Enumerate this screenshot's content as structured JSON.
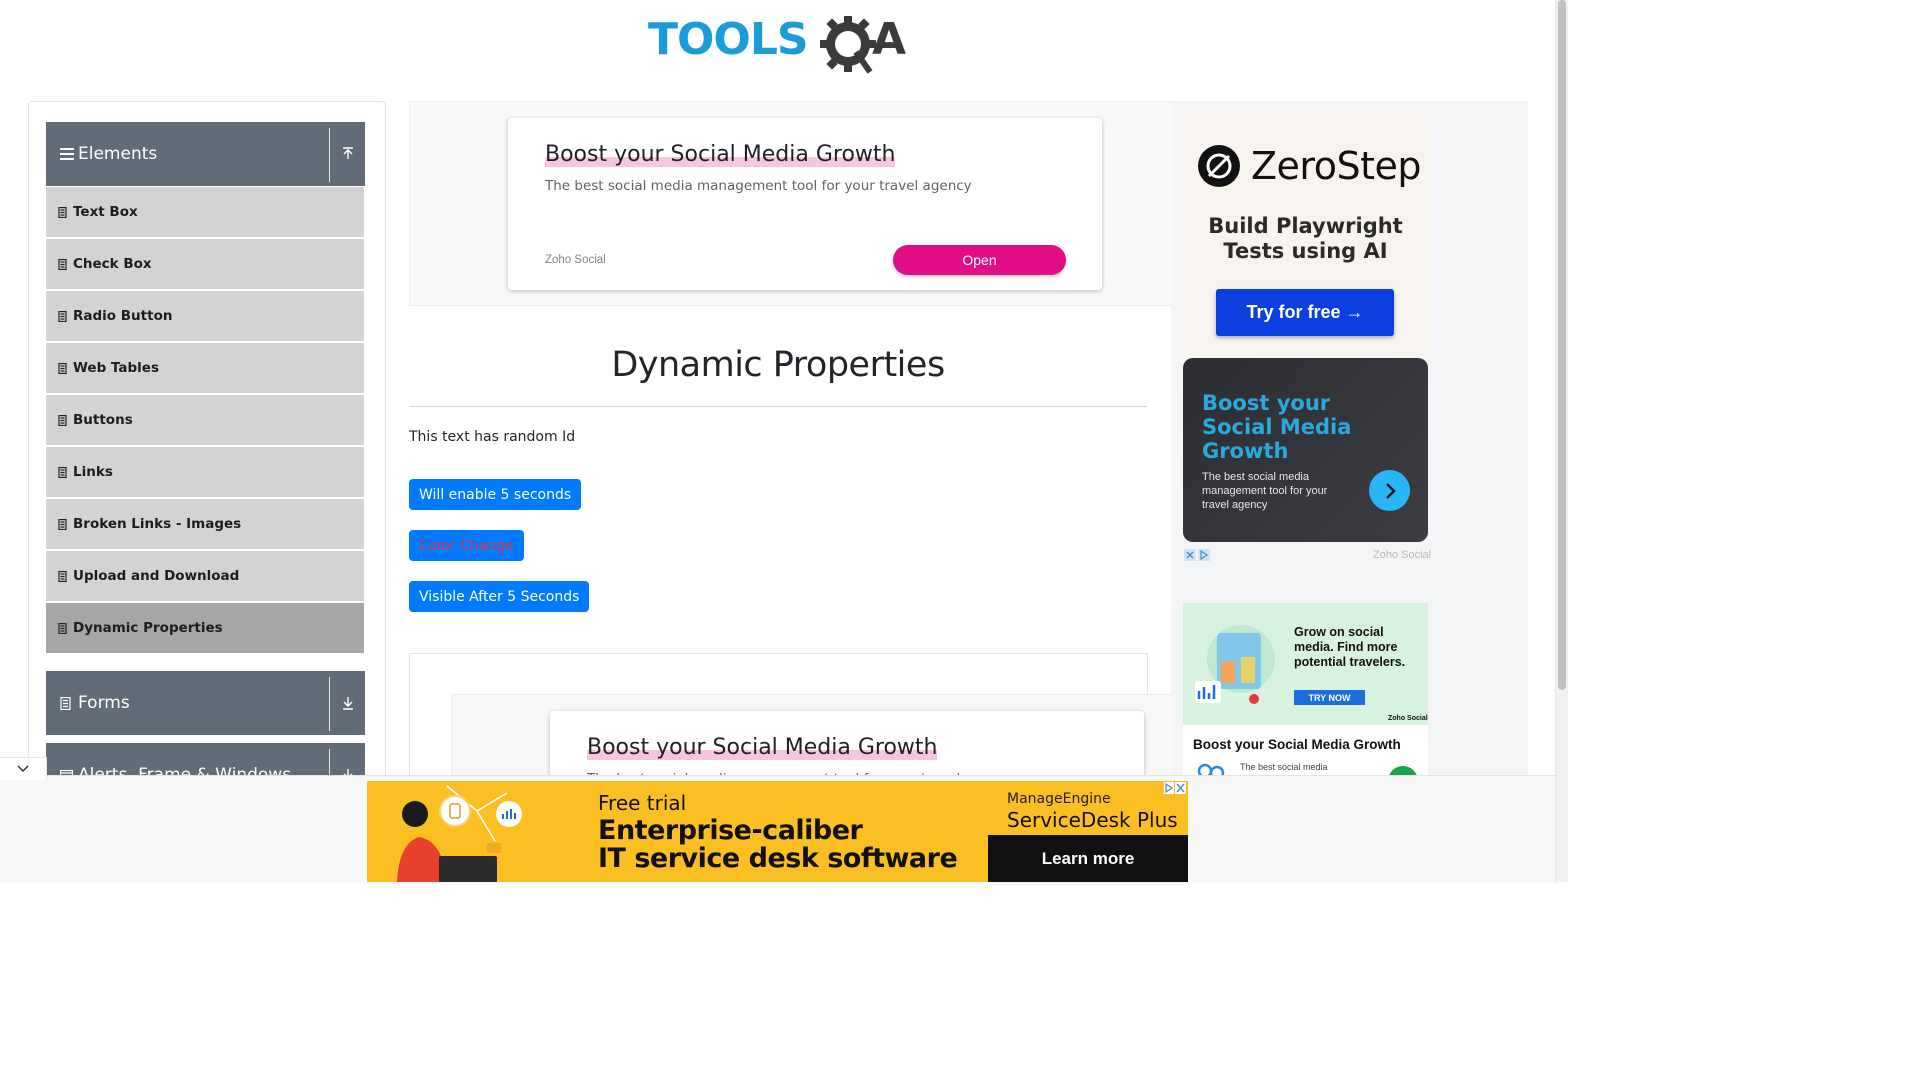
{
  "header": {
    "logo_text_left": "TOOLS",
    "logo_text_right": "A",
    "logo_alt": "ToolsQA"
  },
  "sidebar": {
    "groups": [
      {
        "title": "Elements",
        "toggle": "collapse"
      },
      {
        "title": "Forms",
        "toggle": "expand"
      },
      {
        "title": "Alerts, Frame & Windows",
        "toggle": "expand"
      }
    ],
    "items": [
      {
        "label": "Text Box"
      },
      {
        "label": "Check Box"
      },
      {
        "label": "Radio Button"
      },
      {
        "label": "Web Tables"
      },
      {
        "label": "Buttons"
      },
      {
        "label": "Links"
      },
      {
        "label": "Broken Links - Images"
      },
      {
        "label": "Upload and Download"
      },
      {
        "label": "Dynamic Properties",
        "active": true
      }
    ]
  },
  "top_ad": {
    "title": "Boost your Social Media Growth",
    "desc": "The best social media management tool for your travel agency",
    "brand": "Zoho Social",
    "cta": "Open"
  },
  "main": {
    "title": "Dynamic Properties",
    "random_text": "This text has random Id",
    "buttons": {
      "enable_after": "Will enable 5 seconds",
      "color_change": "Color Change",
      "visible_after": "Visible After 5 Seconds"
    }
  },
  "inner_ad": {
    "title": "Boost your Social Media Growth",
    "desc": "The best social media management tool for your travel agency"
  },
  "right_ads": {
    "zerostep": {
      "name": "ZeroStep",
      "tagline": "Build Playwright Tests using AI",
      "cta": "Try for free →"
    },
    "dark": {
      "title": "Boost your Social Media Growth",
      "desc": "The best social media management tool for your travel agency",
      "brand": "Zoho Social"
    },
    "green": {
      "headline": "Grow on social media. Find more potential travelers.",
      "cta": "TRY NOW",
      "title": "Boost your Social Media Growth",
      "desc": "The best social media",
      "badge": "Zoho Social"
    }
  },
  "bottom_banner": {
    "free": "Free trial",
    "headline_1": "Enterprise-caliber",
    "headline_2": "IT service desk software",
    "brand_1": "ManageEngine",
    "brand_2": "ServiceDesk Plus",
    "cta": "Learn more"
  },
  "colors": {
    "primary": "#007bff",
    "sidebar_header": "#626c78",
    "menu_item": "#d3d3d3",
    "menu_active": "#a6a6a6",
    "zoho_pink": "#e10d84",
    "logo_blue": "#1b9cd8"
  }
}
